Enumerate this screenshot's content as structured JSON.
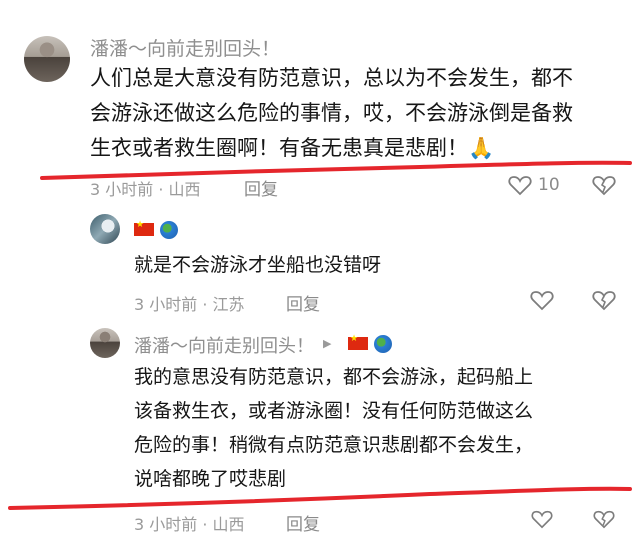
{
  "comment1": {
    "username": "潘潘～向前走别回头！",
    "lines": [
      "人们总是大意没有防范意识，总以为不会发生，都不",
      "会游泳还做这么危险的事情，哎，不会游泳倒是备救",
      "生衣或者救生圈啊！有备无患真是悲剧！🙏"
    ],
    "time": "3 小时前",
    "location": "山西",
    "reply_label": "回复",
    "likes": "10"
  },
  "reply1": {
    "username": "",
    "text": "就是不会游泳才坐船也没错呀",
    "time": "3 小时前",
    "location": "江苏",
    "reply_label": "回复"
  },
  "reply2": {
    "username": "潘潘～向前走别回头！",
    "lines": [
      "我的意思没有防范意识，都不会游泳，起码船上",
      "该备救生衣，或者游泳圈！没有任何防范做这么",
      "危险的事！稍微有点防范意识悲剧都不会发生，",
      "说啥都晚了哎悲剧"
    ],
    "time": "3 小时前",
    "location": "山西",
    "reply_label": "回复"
  },
  "icons": [
    "heart-icon",
    "dislike-heart-icon",
    "flag-china-icon",
    "globe-icon",
    "caret-right-icon",
    "pray-emoji"
  ],
  "colors": {
    "annotation_red": "#e5262c",
    "meta_gray": "#9a9a9a",
    "text": "#161616"
  }
}
